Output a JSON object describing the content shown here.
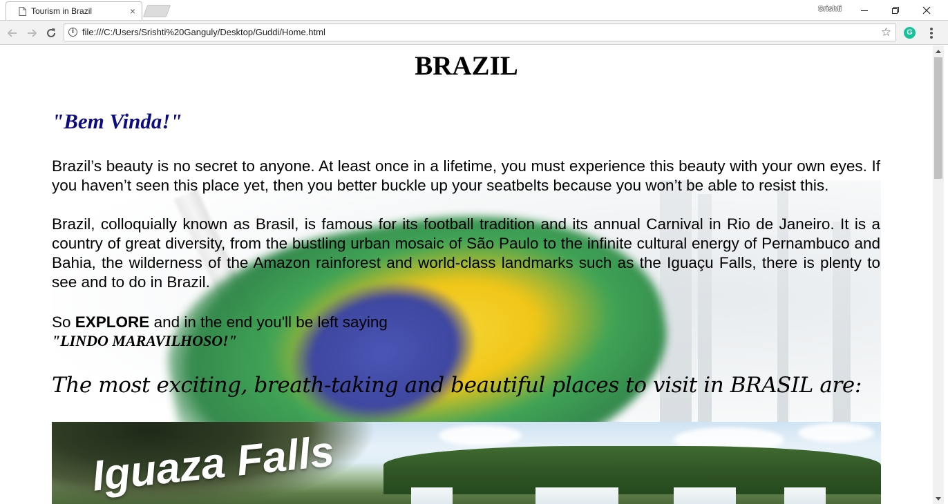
{
  "browser": {
    "tab_title": "Tourism in Brazil",
    "tab_close": "×",
    "profile_name": "Srishti",
    "url": "file:///C:/Users/Srishti%20Ganguly/Desktop/Guddi/Home.html",
    "extension_letter": "G",
    "icons": {
      "back": "arrow-left-icon",
      "forward": "arrow-right-icon",
      "reload": "reload-icon",
      "info": "info-icon",
      "bookmark": "star-icon",
      "menu": "kebab-menu-icon"
    }
  },
  "page": {
    "title": "BRAZIL",
    "welcome": "\"Bem Vinda!\"",
    "paragraph1": "Brazil’s beauty is no secret to anyone. At least once in a lifetime, you must experience this beauty with your own eyes. If you haven’t seen this place yet, then you better buckle up your seatbelts because you won’t be able to resist this.",
    "paragraph2": "Brazil, colloquially known as Brasil, is famous for its football tradition and its annual Carnival in Rio de Janeiro. It is a country of great diversity, from the bustling urban mosaic of São Paulo to the infinite cultural energy of Pernambuco and Bahia, the wilderness of the Amazon rainforest and world-class landmarks such as the Iguaçu Falls, there is plenty to see and to do in Brazil.",
    "explore_prefix": "So ",
    "explore_bold": "EXPLORE",
    "explore_suffix": " and in the end you'll be left saying",
    "lindo": "\"LINDO MARAVILHOSO!\"",
    "places_heading": "The most exciting, breath-taking and beautiful places to visit in BRASIL are:",
    "falls_caption": "Iguaza Falls"
  },
  "colors": {
    "welcome_text": "#0d0d80",
    "extension_badge": "#15c39a"
  }
}
